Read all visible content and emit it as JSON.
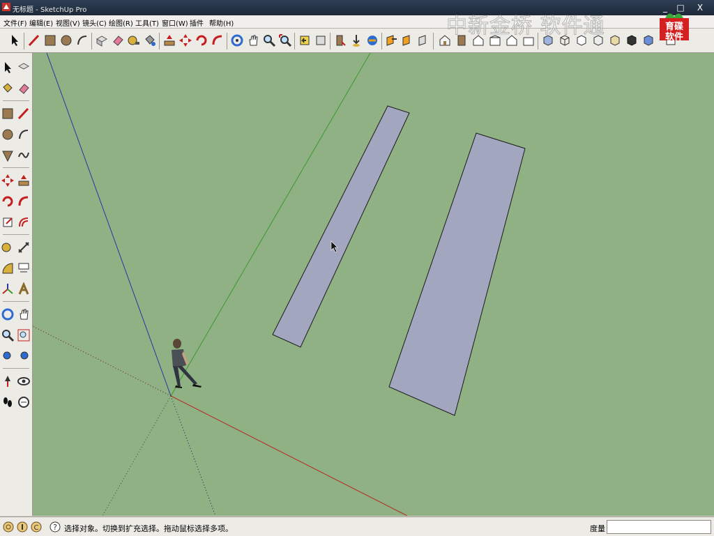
{
  "window": {
    "title": "无标题 - SketchUp Pro",
    "minimize": "_",
    "maximize": "□",
    "close": "X"
  },
  "menu": [
    "文件(F)",
    "编辑(E)",
    "视图(V)",
    "镜头(C)",
    "绘图(R)",
    "工具(T)",
    "窗口(W)",
    "插件",
    "帮助(H)"
  ],
  "watermark": {
    "text": "中新金桥 软件通",
    "logo_line1": "育碟",
    "logo_line2": "软件"
  },
  "status": {
    "text": "选择对象。切换到扩充选择。拖动鼠标选择多项。",
    "measure_label": "度量",
    "measure_value": ""
  },
  "colors": {
    "viewport": "#8fb183",
    "face": "#a3a6bf",
    "axis_red": "#b52a1f",
    "axis_green": "#3a9a2a",
    "axis_blue": "#2536a8"
  }
}
